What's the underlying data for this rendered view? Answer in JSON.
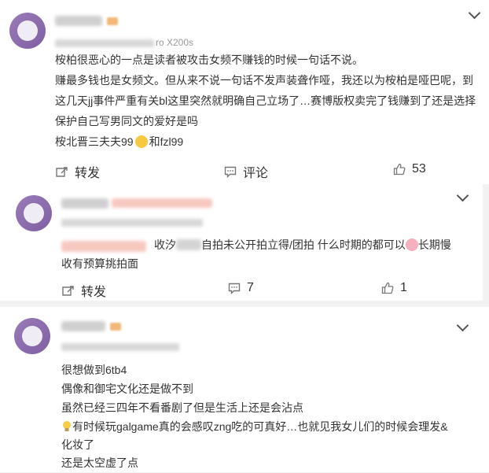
{
  "comments": [
    {
      "device": "ro X200s",
      "lines": [
        "桉柏很恶心的一点是读者被攻击女频不赚钱的时候一句话不说。",
        "赚最多钱也是女频文。但从来不说一句话不发声装聋作哑，我还以为桉柏是哑巴呢，到",
        "这几天jj事件严重有关bl这里突然就明确自己立场了…赛博版权卖完了钱赚到了还是选择",
        "保护自己写男同文的爱好是吗"
      ],
      "tag_line_a": "桉北晋三夫夫99",
      "tag_line_b": "和fzl99",
      "repost_label": "转发",
      "comment_label": "评论",
      "like_count": "53"
    },
    {
      "line1_a": "收汐",
      "line1_b": "自拍未公开拍立得/团拍 什么时期的都可以",
      "line1_c": "长期慢",
      "line2": "收有预算挑拍面",
      "repost_label": "转发",
      "comment_count": "7",
      "like_count": "1"
    },
    {
      "lines": [
        "很想做到6tb4",
        "偶像和御宅文化还是做不到",
        "虽然已经三四年不看番剧了但是生活上还是会沾点"
      ],
      "line4": "有时候玩galgame真的会感叹zng吃的可真好…也就见我女儿们的时候会理发&",
      "line5": "化妆了",
      "line6": "还是太空虚了点"
    }
  ],
  "icons": [
    "chevron-down-icon",
    "repost-icon",
    "comment-icon",
    "like-icon",
    "lightbulb-icon"
  ]
}
